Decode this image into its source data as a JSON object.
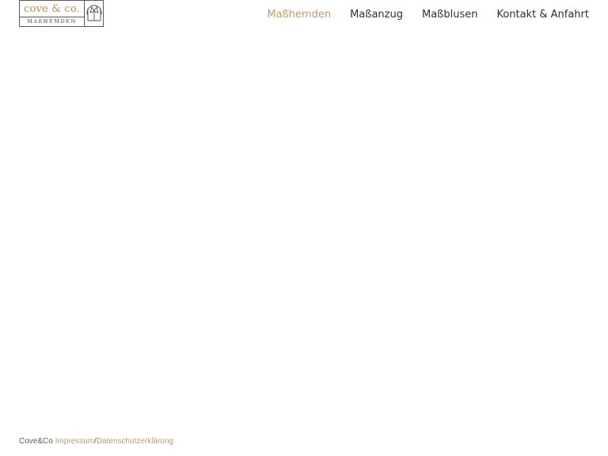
{
  "logo": {
    "brand": "cove & co.",
    "subtitle": "MAßHEMDEN",
    "icon": "shirt-icon"
  },
  "nav": {
    "items": [
      {
        "label": "Maßhemden",
        "active": true
      },
      {
        "label": "Maßanzug",
        "active": false
      },
      {
        "label": "Maßblusen",
        "active": false
      },
      {
        "label": "Kontakt & Anfahrt",
        "active": false
      }
    ]
  },
  "footer": {
    "copyright": "Cove&Co",
    "impressum": "Impressum",
    "separator": "/",
    "datenschutz": "Datenschutzerklärung"
  },
  "colors": {
    "accent": "#c19a6b",
    "text": "#2e2e2e",
    "logo_border": "#5a5a5a"
  }
}
